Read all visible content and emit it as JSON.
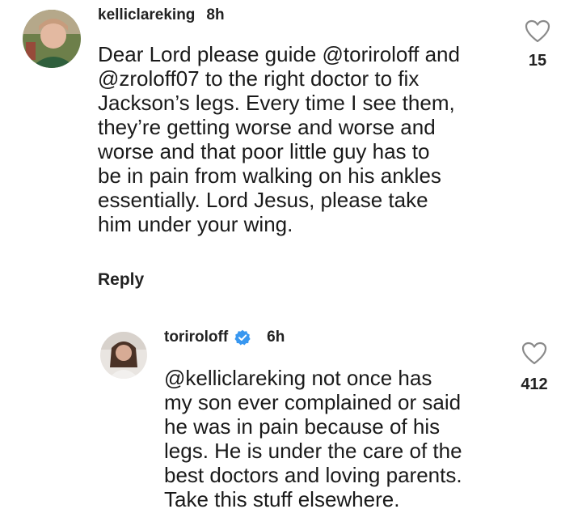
{
  "comments": [
    {
      "username": "kelliclareking",
      "time": "8h",
      "lines": [
        "Dear Lord please guide @toriroloff  and",
        "@zroloff07 to the right doctor to fix",
        "Jackson’s legs.  Every time I see them,",
        "they’re getting worse and worse and",
        "worse and that poor little guy has to",
        "be in pain from walking on his ankles",
        "essentially. Lord Jesus, please take",
        "him under your wing."
      ],
      "reply_label": "Reply",
      "like_count": "15"
    },
    {
      "username": "toriroloff",
      "verified": true,
      "time": "6h",
      "lines": [
        "@kelliclareking not once has",
        "my son ever complained or said",
        "he was in pain because of his",
        "legs. He is under the care of the",
        "best doctors and loving parents.",
        "Take this stuff elsewhere."
      ],
      "like_count": "412"
    }
  ],
  "icons": {
    "like": "heart-outline-icon",
    "verified": "verified-badge-icon"
  },
  "colors": {
    "verified_blue": "#3897f0",
    "text": "#1a1a1a",
    "heart_outline": "#888888"
  }
}
